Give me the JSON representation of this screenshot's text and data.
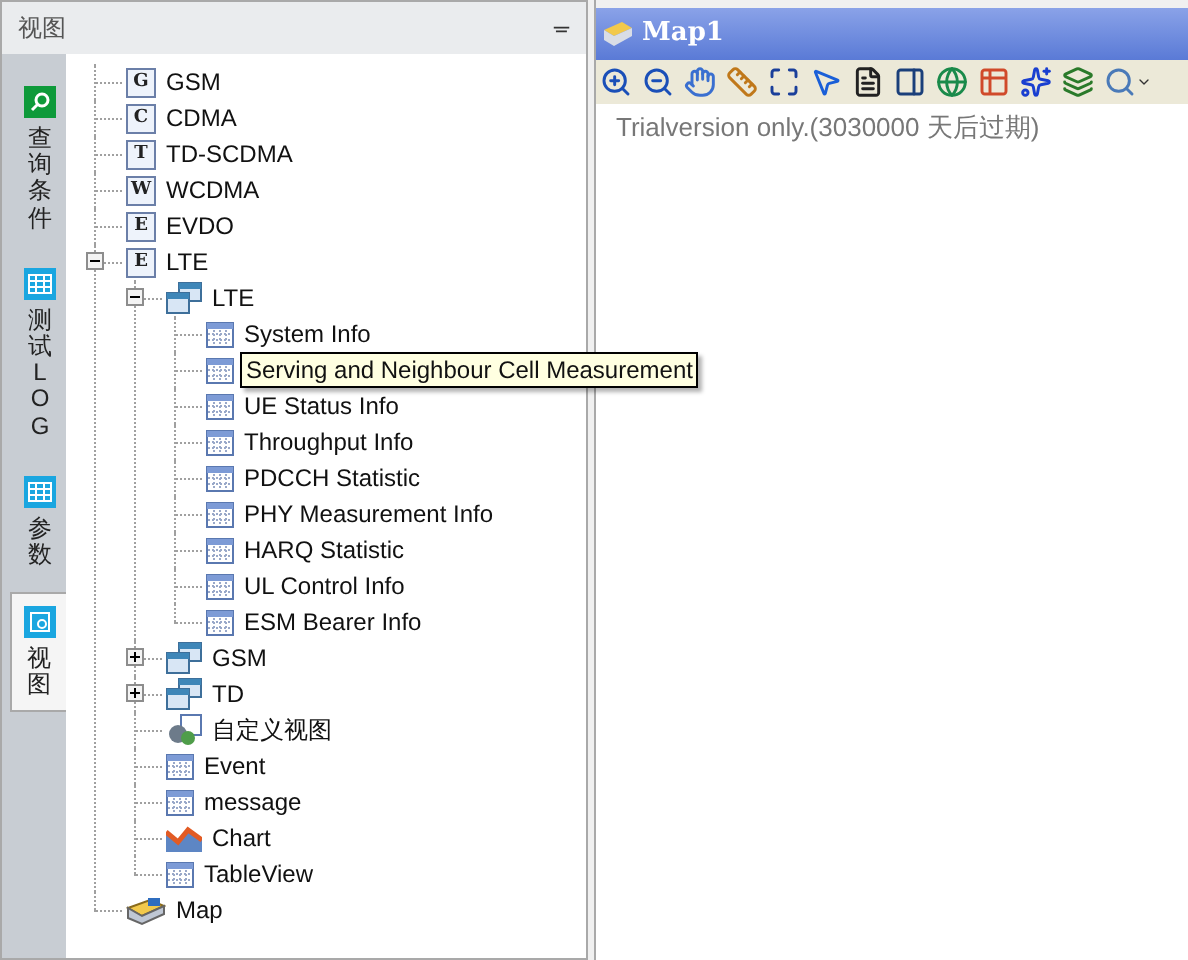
{
  "left_panel": {
    "title": "视图",
    "pin": "ᚚ"
  },
  "side_tabs": [
    {
      "label": "查询条件",
      "kind": "search",
      "selected": false
    },
    {
      "label": "测试LOG",
      "kind": "grid",
      "selected": false
    },
    {
      "label": "参数",
      "kind": "grid",
      "selected": false
    },
    {
      "label": "视图",
      "kind": "view",
      "selected": true
    }
  ],
  "tree": [
    {
      "label": "GSM",
      "kind": "letter",
      "badge": "G"
    },
    {
      "label": "CDMA",
      "kind": "letter",
      "badge": "C"
    },
    {
      "label": "TD-SCDMA",
      "kind": "letter",
      "badge": "T"
    },
    {
      "label": "WCDMA",
      "kind": "letter",
      "badge": "W"
    },
    {
      "label": "EVDO",
      "kind": "letter",
      "badge": "E"
    },
    {
      "label": "LTE",
      "kind": "letter",
      "badge": "E",
      "expanded": true,
      "children": [
        {
          "label": "LTE",
          "kind": "group",
          "expanded": true,
          "children": [
            {
              "label": "System Info",
              "kind": "grid"
            },
            {
              "label": "Serving and Neighbour Cell Measurement",
              "kind": "grid",
              "tooltip": true
            },
            {
              "label": "UE Status Info",
              "kind": "grid"
            },
            {
              "label": "Throughput Info",
              "kind": "grid"
            },
            {
              "label": "PDCCH Statistic",
              "kind": "grid"
            },
            {
              "label": "PHY Measurement Info",
              "kind": "grid"
            },
            {
              "label": "HARQ Statistic",
              "kind": "grid"
            },
            {
              "label": "UL Control Info",
              "kind": "grid"
            },
            {
              "label": "ESM Bearer Info",
              "kind": "grid"
            }
          ]
        },
        {
          "label": "GSM",
          "kind": "group",
          "expanded": false
        },
        {
          "label": "TD",
          "kind": "group",
          "expanded": false
        },
        {
          "label": "自定义视图",
          "kind": "custom"
        },
        {
          "label": "Event",
          "kind": "grid"
        },
        {
          "label": "message",
          "kind": "grid"
        },
        {
          "label": "Chart",
          "kind": "chart"
        },
        {
          "label": "TableView",
          "kind": "grid"
        }
      ]
    },
    {
      "label": "Map",
      "kind": "map"
    }
  ],
  "map_window": {
    "title": "Map1",
    "notice": "Trialversion only.(3030000 天后过期)"
  }
}
